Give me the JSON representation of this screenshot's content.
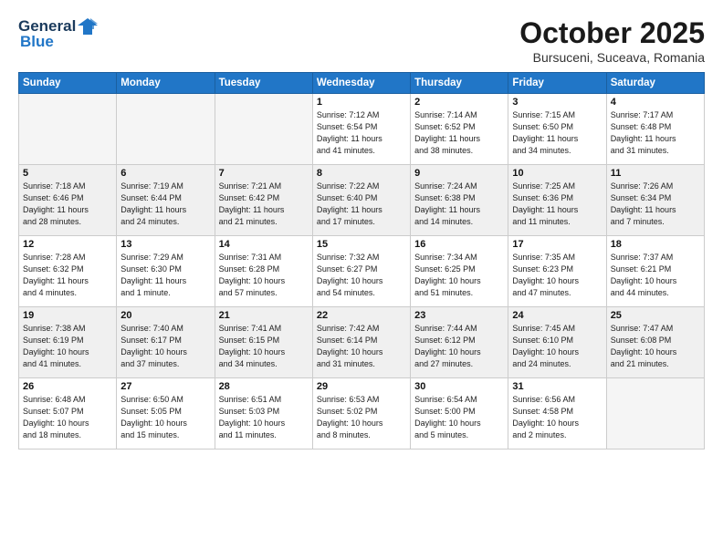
{
  "header": {
    "logo_line1": "General",
    "logo_line2": "Blue",
    "month": "October 2025",
    "location": "Bursuceni, Suceava, Romania"
  },
  "weekdays": [
    "Sunday",
    "Monday",
    "Tuesday",
    "Wednesday",
    "Thursday",
    "Friday",
    "Saturday"
  ],
  "weeks": [
    [
      {
        "day": "",
        "info": ""
      },
      {
        "day": "",
        "info": ""
      },
      {
        "day": "",
        "info": ""
      },
      {
        "day": "1",
        "info": "Sunrise: 7:12 AM\nSunset: 6:54 PM\nDaylight: 11 hours\nand 41 minutes."
      },
      {
        "day": "2",
        "info": "Sunrise: 7:14 AM\nSunset: 6:52 PM\nDaylight: 11 hours\nand 38 minutes."
      },
      {
        "day": "3",
        "info": "Sunrise: 7:15 AM\nSunset: 6:50 PM\nDaylight: 11 hours\nand 34 minutes."
      },
      {
        "day": "4",
        "info": "Sunrise: 7:17 AM\nSunset: 6:48 PM\nDaylight: 11 hours\nand 31 minutes."
      }
    ],
    [
      {
        "day": "5",
        "info": "Sunrise: 7:18 AM\nSunset: 6:46 PM\nDaylight: 11 hours\nand 28 minutes."
      },
      {
        "day": "6",
        "info": "Sunrise: 7:19 AM\nSunset: 6:44 PM\nDaylight: 11 hours\nand 24 minutes."
      },
      {
        "day": "7",
        "info": "Sunrise: 7:21 AM\nSunset: 6:42 PM\nDaylight: 11 hours\nand 21 minutes."
      },
      {
        "day": "8",
        "info": "Sunrise: 7:22 AM\nSunset: 6:40 PM\nDaylight: 11 hours\nand 17 minutes."
      },
      {
        "day": "9",
        "info": "Sunrise: 7:24 AM\nSunset: 6:38 PM\nDaylight: 11 hours\nand 14 minutes."
      },
      {
        "day": "10",
        "info": "Sunrise: 7:25 AM\nSunset: 6:36 PM\nDaylight: 11 hours\nand 11 minutes."
      },
      {
        "day": "11",
        "info": "Sunrise: 7:26 AM\nSunset: 6:34 PM\nDaylight: 11 hours\nand 7 minutes."
      }
    ],
    [
      {
        "day": "12",
        "info": "Sunrise: 7:28 AM\nSunset: 6:32 PM\nDaylight: 11 hours\nand 4 minutes."
      },
      {
        "day": "13",
        "info": "Sunrise: 7:29 AM\nSunset: 6:30 PM\nDaylight: 11 hours\nand 1 minute."
      },
      {
        "day": "14",
        "info": "Sunrise: 7:31 AM\nSunset: 6:28 PM\nDaylight: 10 hours\nand 57 minutes."
      },
      {
        "day": "15",
        "info": "Sunrise: 7:32 AM\nSunset: 6:27 PM\nDaylight: 10 hours\nand 54 minutes."
      },
      {
        "day": "16",
        "info": "Sunrise: 7:34 AM\nSunset: 6:25 PM\nDaylight: 10 hours\nand 51 minutes."
      },
      {
        "day": "17",
        "info": "Sunrise: 7:35 AM\nSunset: 6:23 PM\nDaylight: 10 hours\nand 47 minutes."
      },
      {
        "day": "18",
        "info": "Sunrise: 7:37 AM\nSunset: 6:21 PM\nDaylight: 10 hours\nand 44 minutes."
      }
    ],
    [
      {
        "day": "19",
        "info": "Sunrise: 7:38 AM\nSunset: 6:19 PM\nDaylight: 10 hours\nand 41 minutes."
      },
      {
        "day": "20",
        "info": "Sunrise: 7:40 AM\nSunset: 6:17 PM\nDaylight: 10 hours\nand 37 minutes."
      },
      {
        "day": "21",
        "info": "Sunrise: 7:41 AM\nSunset: 6:15 PM\nDaylight: 10 hours\nand 34 minutes."
      },
      {
        "day": "22",
        "info": "Sunrise: 7:42 AM\nSunset: 6:14 PM\nDaylight: 10 hours\nand 31 minutes."
      },
      {
        "day": "23",
        "info": "Sunrise: 7:44 AM\nSunset: 6:12 PM\nDaylight: 10 hours\nand 27 minutes."
      },
      {
        "day": "24",
        "info": "Sunrise: 7:45 AM\nSunset: 6:10 PM\nDaylight: 10 hours\nand 24 minutes."
      },
      {
        "day": "25",
        "info": "Sunrise: 7:47 AM\nSunset: 6:08 PM\nDaylight: 10 hours\nand 21 minutes."
      }
    ],
    [
      {
        "day": "26",
        "info": "Sunrise: 6:48 AM\nSunset: 5:07 PM\nDaylight: 10 hours\nand 18 minutes."
      },
      {
        "day": "27",
        "info": "Sunrise: 6:50 AM\nSunset: 5:05 PM\nDaylight: 10 hours\nand 15 minutes."
      },
      {
        "day": "28",
        "info": "Sunrise: 6:51 AM\nSunset: 5:03 PM\nDaylight: 10 hours\nand 11 minutes."
      },
      {
        "day": "29",
        "info": "Sunrise: 6:53 AM\nSunset: 5:02 PM\nDaylight: 10 hours\nand 8 minutes."
      },
      {
        "day": "30",
        "info": "Sunrise: 6:54 AM\nSunset: 5:00 PM\nDaylight: 10 hours\nand 5 minutes."
      },
      {
        "day": "31",
        "info": "Sunrise: 6:56 AM\nSunset: 4:58 PM\nDaylight: 10 hours\nand 2 minutes."
      },
      {
        "day": "",
        "info": ""
      }
    ]
  ]
}
